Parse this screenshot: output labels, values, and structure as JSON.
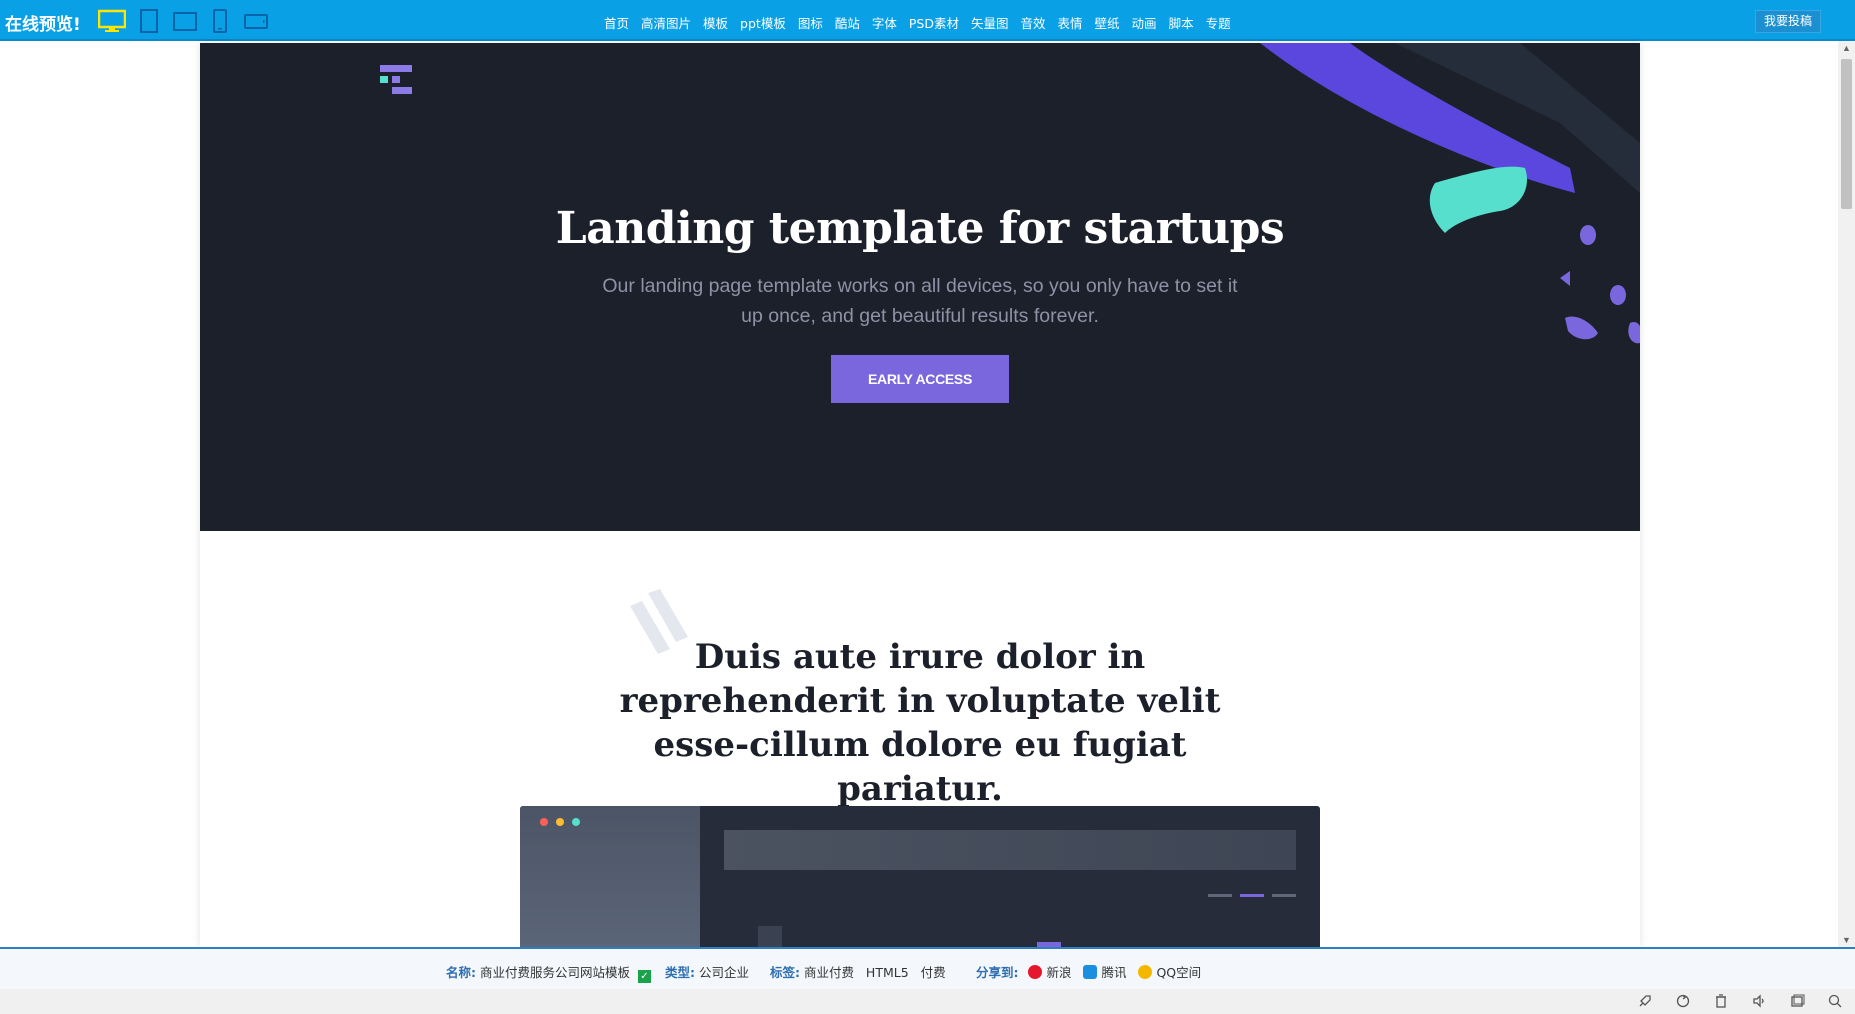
{
  "topbar": {
    "brand": "在线预览!",
    "devices": [
      "desktop-icon",
      "tablet-portrait-icon",
      "tablet-landscape-icon",
      "phone-portrait-icon",
      "phone-landscape-icon"
    ],
    "nav": [
      "首页",
      "高清图片",
      "模板",
      "ppt模板",
      "图标",
      "酷站",
      "字体",
      "PSD素材",
      "矢量图",
      "音效",
      "表情",
      "壁纸",
      "动画",
      "脚本",
      "专题"
    ],
    "submit_label": "我要投稿",
    "colors": {
      "bar": "#0aa0e6",
      "active_device": "#ffe600"
    }
  },
  "hero": {
    "title": "Landing template for startups",
    "subtitle": "Our landing page template works on all devices, so you only have to set it up once, and get beautiful results forever.",
    "cta": "Early access",
    "colors": {
      "background": "#1c202a",
      "cta": "#7b67dd",
      "accent_teal": "#55dfcc",
      "accent_purple": "#5b47dd"
    }
  },
  "section2": {
    "heading": "Duis aute irure dolor in reprehenderit in voluptate velit esse-cillum dolore eu fugiat pariatur."
  },
  "infobar": {
    "name_label": "名称:",
    "name_value": "商业付费服务公司网站模板",
    "type_label": "类型:",
    "type_value": "公司企业",
    "tags_label": "标签:",
    "tags": [
      "商业付费",
      "HTML5",
      "付费"
    ],
    "share_label": "分享到:",
    "share_targets": [
      "新浪",
      "腾讯",
      "QQ空间"
    ]
  }
}
